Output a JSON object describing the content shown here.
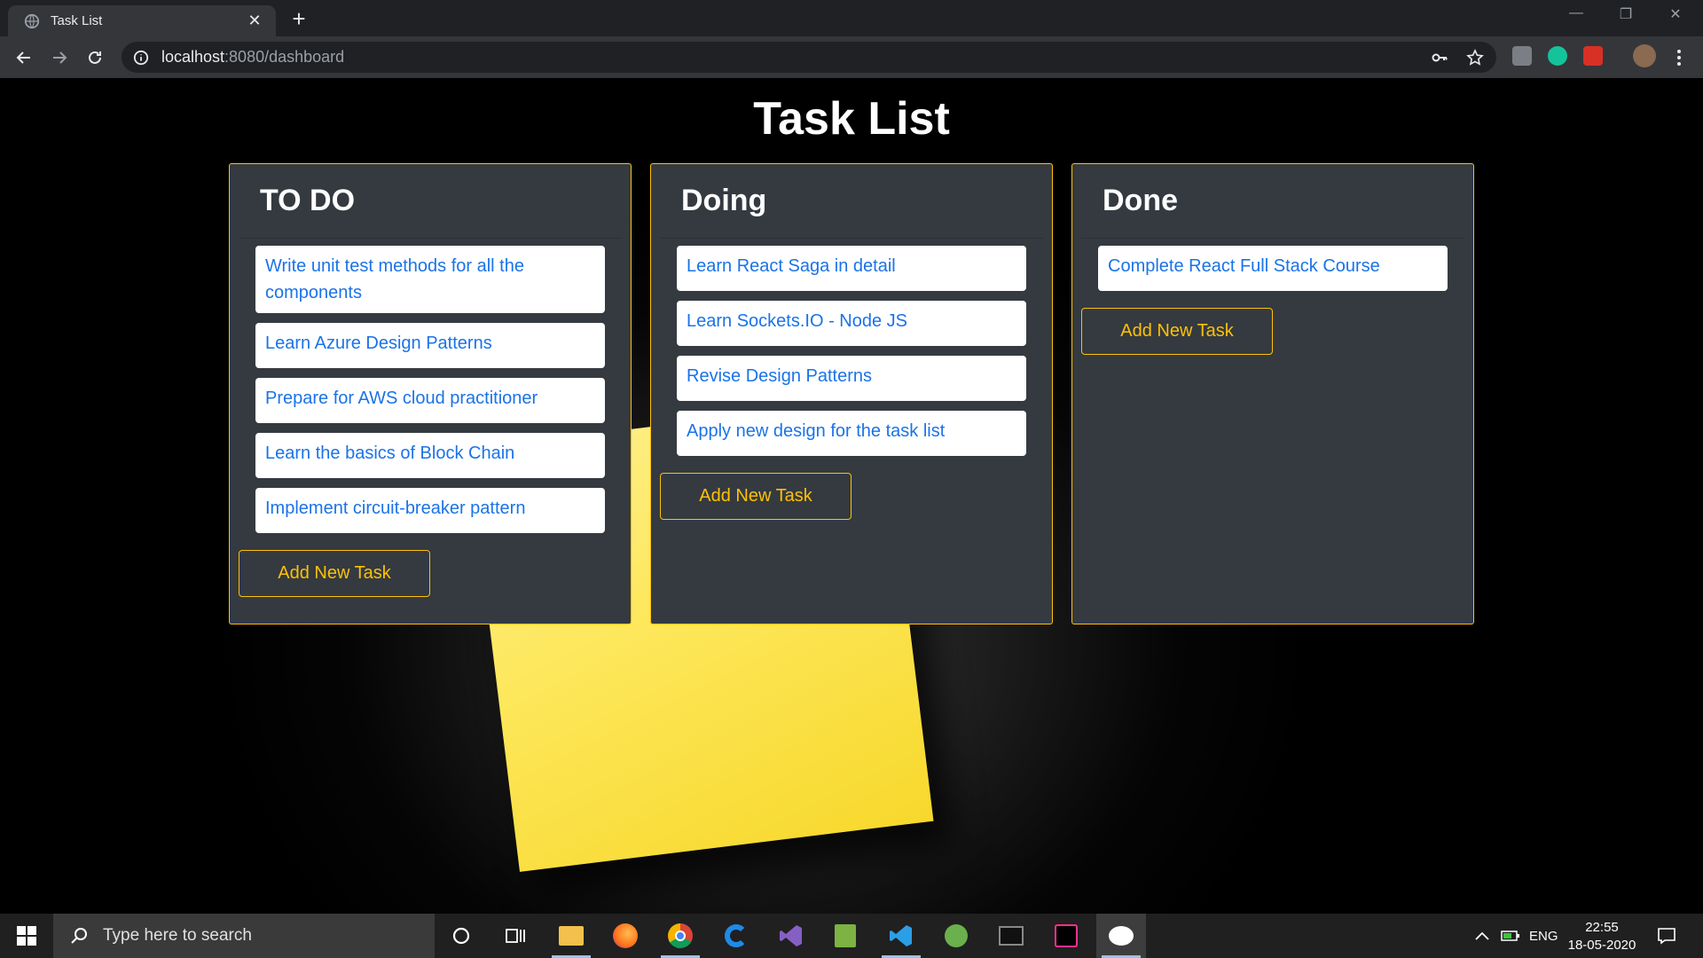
{
  "browser": {
    "tab_title": "Task List",
    "url_host": "localhost",
    "url_path": ":8080/dashboard"
  },
  "page": {
    "title": "Task List"
  },
  "columns": [
    {
      "title": "TO DO",
      "tasks": [
        "Write unit test methods for all the components",
        "Learn Azure Design Patterns",
        "Prepare for AWS cloud practitioner",
        "Learn the basics of Block Chain",
        "Implement circuit-breaker pattern"
      ],
      "add_label": "Add New Task"
    },
    {
      "title": "Doing",
      "tasks": [
        "Learn React Saga in detail",
        "Learn Sockets.IO - Node JS",
        "Revise Design Patterns",
        "Apply new design for the task list"
      ],
      "add_label": "Add New Task"
    },
    {
      "title": "Done",
      "tasks": [
        "Complete React Full Stack Course"
      ],
      "add_label": "Add New Task"
    }
  ],
  "taskbar": {
    "search_placeholder": "Type here to search",
    "language": "ENG",
    "time": "22:55",
    "date": "18-05-2020"
  },
  "colors": {
    "accent": "#ffc107",
    "card_bg": "#343a40",
    "task_text": "#1a73e8"
  }
}
